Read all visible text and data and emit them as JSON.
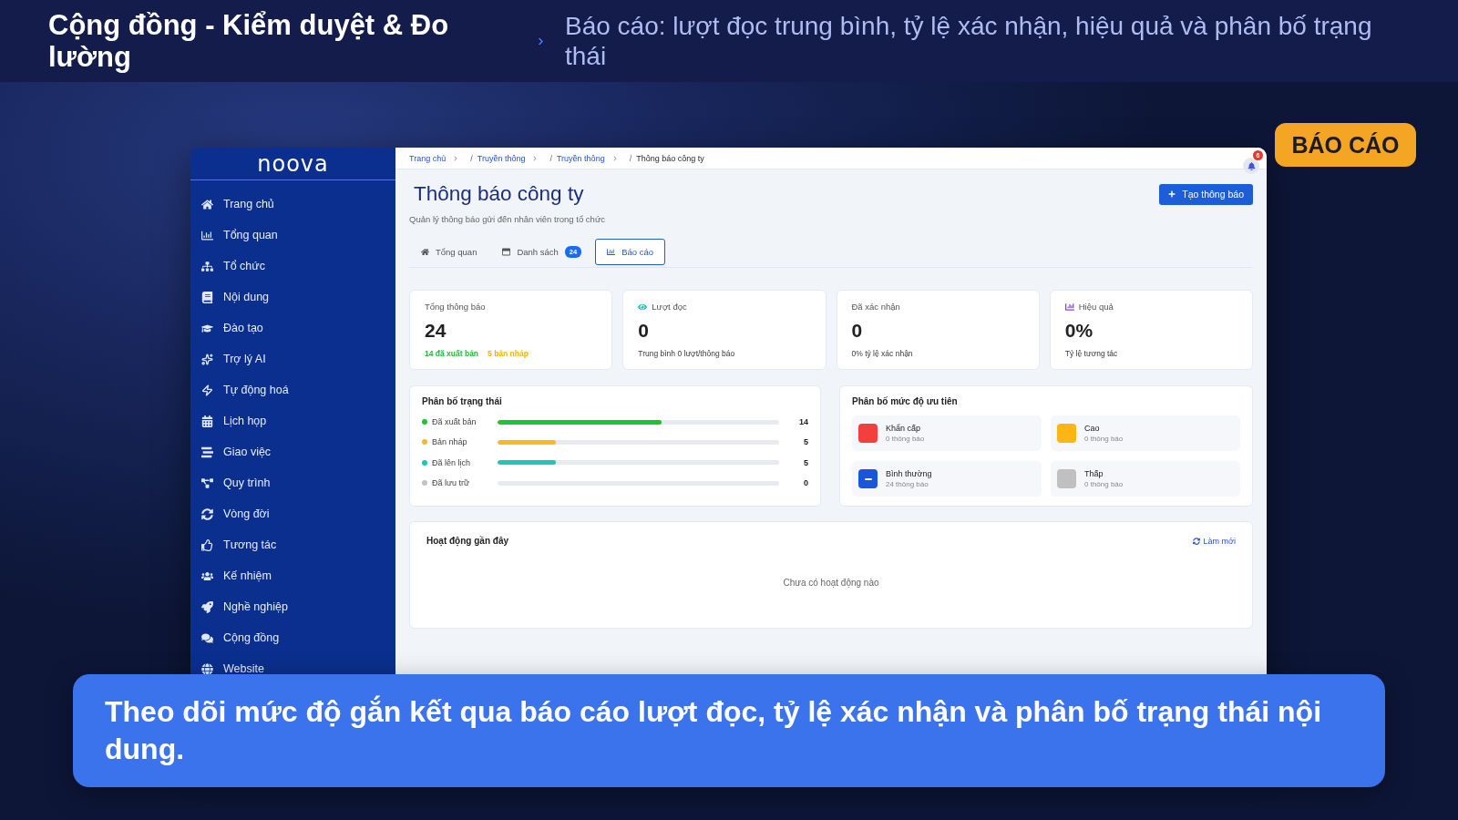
{
  "header": {
    "title": "Cộng đồng - Kiểm duyệt & Đo lường",
    "subtitle": "Báo cáo: lượt đọc trung bình, tỷ lệ xác nhận, hiệu quả và phân bố trạng thái"
  },
  "badge": "BÁO CÁO",
  "sidebar": {
    "logo": "noova",
    "items": [
      {
        "label": "Trang chủ"
      },
      {
        "label": "Tổng quan"
      },
      {
        "label": "Tổ chức"
      },
      {
        "label": "Nội dung"
      },
      {
        "label": "Đào tạo"
      },
      {
        "label": "Trợ lý AI"
      },
      {
        "label": "Tự động hoá"
      },
      {
        "label": "Lịch họp"
      },
      {
        "label": "Giao việc"
      },
      {
        "label": "Quy trình"
      },
      {
        "label": "Vòng đời"
      },
      {
        "label": "Tương tác"
      },
      {
        "label": "Kế nhiệm"
      },
      {
        "label": "Nghề nghiệp"
      },
      {
        "label": "Cộng đồng"
      },
      {
        "label": "Website"
      }
    ]
  },
  "breadcrumb": {
    "separator": "/",
    "items": [
      {
        "label": "Trang chủ",
        "current": false
      },
      {
        "label": "Truyền thông",
        "current": false
      },
      {
        "label": "Truyền thông",
        "current": false
      },
      {
        "label": "Thông báo công ty",
        "current": true
      }
    ]
  },
  "notifications": {
    "count": "6"
  },
  "page": {
    "title": "Thông báo công ty",
    "subtitle": "Quản lý thông báo gửi đến nhân viên trong tổ chức",
    "create_button": "Tạo thông báo"
  },
  "tabs": [
    {
      "label": "Tổng quan",
      "selected": false
    },
    {
      "label": "Danh sách",
      "badge": "24",
      "selected": false
    },
    {
      "label": "Báo cáo",
      "selected": true
    }
  ],
  "stats": [
    {
      "label": "Tổng thông báo",
      "value": "24",
      "notes": [
        {
          "text": "14 đã xuất bản",
          "color": "#22b936"
        },
        {
          "text": "5 bản nháp",
          "color": "#f5b400"
        }
      ]
    },
    {
      "label": "Lượt đọc",
      "value": "0",
      "notes": [
        {
          "text": "Trung bình 0 lượt/thông báo"
        }
      ]
    },
    {
      "label": "Đã xác nhận",
      "value": "0",
      "notes": [
        {
          "text": "0% tỷ lệ xác nhận"
        }
      ]
    },
    {
      "label": "Hiệu quả",
      "value": "0%",
      "notes": [
        {
          "text": "Tỷ lệ tương tác"
        }
      ]
    }
  ],
  "status_distribution": {
    "title": "Phân bố trạng thái",
    "rows": [
      {
        "label": "Đã xuất bản",
        "count": "14",
        "color": "#1ec42f",
        "level": 0.583
      },
      {
        "label": "Bản nháp",
        "count": "5",
        "color": "#fbb72a",
        "level": 0.208
      },
      {
        "label": "Đã lên lịch",
        "count": "5",
        "color": "#1cc8b2",
        "level": 0.208
      },
      {
        "label": "Đã lưu trữ",
        "count": "0",
        "color": "#c2c2c2"
      }
    ]
  },
  "priority_distribution": {
    "title": "Phân bố mức độ ưu tiên",
    "items": [
      {
        "name": "Khẩn cấp",
        "count": "0 thông báo",
        "color": "#f43f3f",
        "kind": "plain"
      },
      {
        "name": "Cao",
        "count": "0 thông báo",
        "color": "#fbb514",
        "kind": "plain"
      },
      {
        "name": "Bình thường",
        "count": "24 thông báo",
        "color": "#1a56db",
        "kind": "minus"
      },
      {
        "name": "Thấp",
        "count": "0 thông báo",
        "color": "#c0c0c0",
        "kind": "plain"
      }
    ]
  },
  "recent_activity": {
    "title": "Hoạt động gần đây",
    "refresh": "Làm mới",
    "empty": "Chưa có hoạt động nào"
  },
  "caption": "Theo dõi mức độ gắn kết qua báo cáo lượt đọc, tỷ lệ xác nhận và phân bố trạng thái nội dung."
}
